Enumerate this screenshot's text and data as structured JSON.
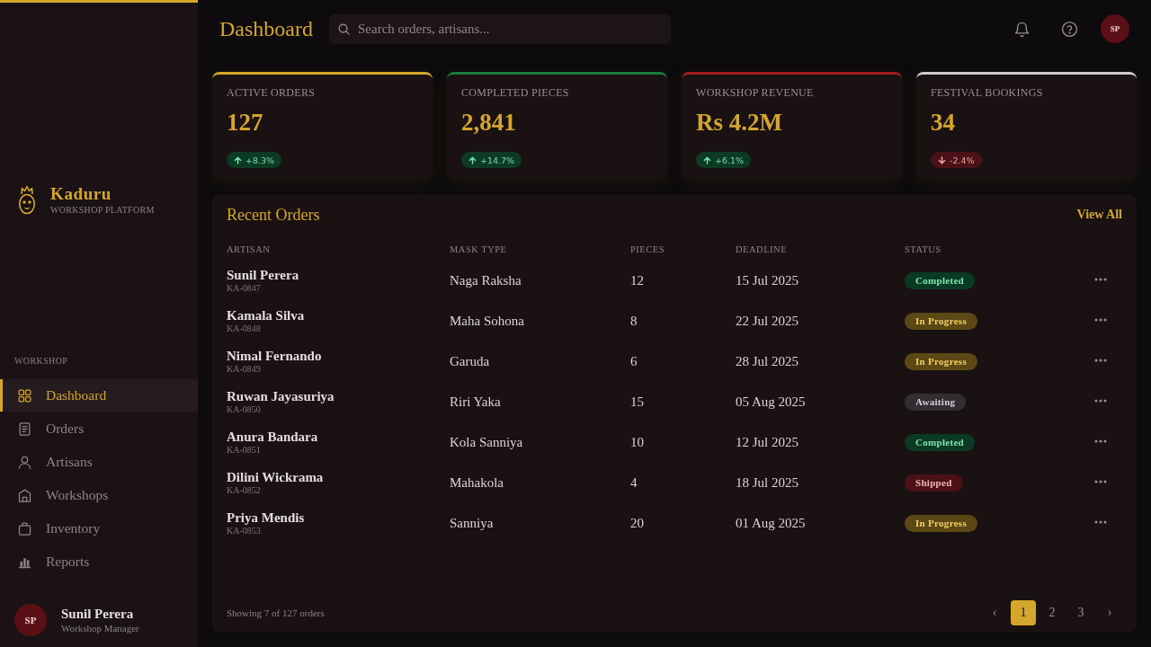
{
  "sidebar": {
    "brand": {
      "name": "Kaduru",
      "tagline": "WORKSHOP PLATFORM"
    },
    "section_label": "WORKSHOP",
    "items": [
      {
        "label": "Dashboard",
        "selected": true
      },
      {
        "label": "Orders",
        "selected": false
      },
      {
        "label": "Artisans",
        "selected": false
      },
      {
        "label": "Workshops",
        "selected": false
      },
      {
        "label": "Inventory",
        "selected": false
      },
      {
        "label": "Reports",
        "selected": false
      }
    ],
    "user": {
      "initials": "SP",
      "name": "Sunil Perera",
      "role": "Workshop Manager"
    }
  },
  "header": {
    "title": "Dashboard",
    "search": {
      "placeholder": "Search orders, artisans..."
    },
    "avatar_initials": "SP"
  },
  "stats": [
    {
      "label": "ACTIVE ORDERS",
      "value": "127",
      "color": "#d4a72c",
      "delta": {
        "text": "+8.3%",
        "negative": false
      }
    },
    {
      "label": "COMPLETED PIECES",
      "value": "2,841",
      "color": "#1b7a3e",
      "delta": {
        "text": "+14.7%",
        "negative": false
      }
    },
    {
      "label": "WORKSHOP REVENUE",
      "value": "Rs 4.2M",
      "color": "#a51d22",
      "delta": {
        "text": "+6.1%",
        "negative": false
      }
    },
    {
      "label": "FESTIVAL BOOKINGS",
      "value": "34",
      "color": "#cfcccf",
      "delta": {
        "text": "-2.4%",
        "negative": true
      }
    }
  ],
  "orders": {
    "title": "Recent Orders",
    "link": "View All",
    "columns": [
      "ARTISAN",
      "MASK TYPE",
      "PIECES",
      "DEADLINE",
      "STATUS"
    ],
    "rows": [
      {
        "artisan": "Sunil Perera",
        "id": "KA-0847",
        "mask_type": "Naga Raksha",
        "pieces": "12",
        "deadline": "15 Jul 2025",
        "status": {
          "text": "Completed",
          "kind": "completed"
        }
      },
      {
        "artisan": "Kamala Silva",
        "id": "KA-0848",
        "mask_type": "Maha Sohona",
        "pieces": "8",
        "deadline": "22 Jul 2025",
        "status": {
          "text": "In Progress",
          "kind": "progress"
        }
      },
      {
        "artisan": "Nimal Fernando",
        "id": "KA-0849",
        "mask_type": "Garuda",
        "pieces": "6",
        "deadline": "28 Jul 2025",
        "status": {
          "text": "In Progress",
          "kind": "progress"
        }
      },
      {
        "artisan": "Ruwan Jayasuriya",
        "id": "KA-0850",
        "mask_type": "Riri Yaka",
        "pieces": "15",
        "deadline": "05 Aug 2025",
        "status": {
          "text": "Awaiting",
          "kind": "awaiting"
        }
      },
      {
        "artisan": "Anura Bandara",
        "id": "KA-0851",
        "mask_type": "Kola Sanniya",
        "pieces": "10",
        "deadline": "12 Jul 2025",
        "status": {
          "text": "Completed",
          "kind": "completed"
        }
      },
      {
        "artisan": "Dilini Wickrama",
        "id": "KA-0852",
        "mask_type": "Mahakola",
        "pieces": "4",
        "deadline": "18 Jul 2025",
        "status": {
          "text": "Shipped",
          "kind": "shipped"
        }
      },
      {
        "artisan": "Priya Mendis",
        "id": "KA-0853",
        "mask_type": "Sanniya",
        "pieces": "20",
        "deadline": "01 Aug 2025",
        "status": {
          "text": "In Progress",
          "kind": "progress"
        }
      }
    ],
    "footer": "Showing 7 of 127 orders",
    "pagination": {
      "prev": "‹",
      "pages": [
        {
          "label": "1",
          "selected": true
        },
        {
          "label": "2",
          "selected": false
        },
        {
          "label": "3",
          "selected": false
        }
      ],
      "next": "›"
    }
  }
}
